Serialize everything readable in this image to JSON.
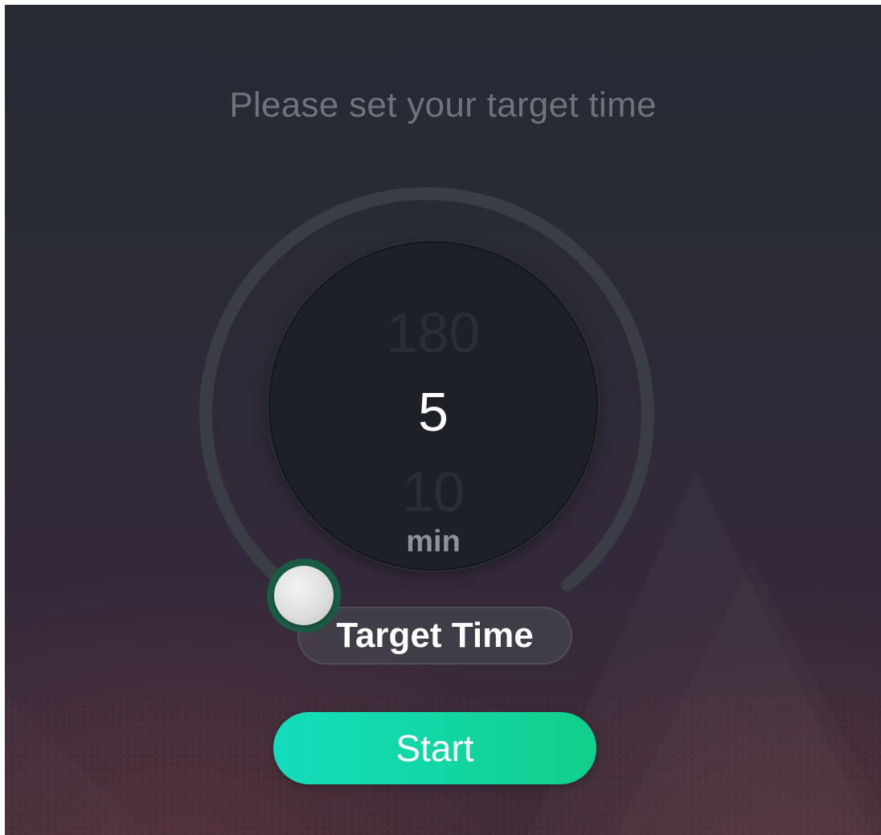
{
  "header": {
    "title": "Please set your target time"
  },
  "picker": {
    "previous_value": "180",
    "current_value": "5",
    "next_value": "10",
    "unit": "min"
  },
  "slider": {
    "label": "Target Time",
    "progress_fraction": 0.0
  },
  "actions": {
    "start_label": "Start"
  },
  "colors": {
    "accent_start": "#13ddbd",
    "accent_end": "#12cf8a",
    "handle_ring": "#1a5b46",
    "track": "#3a3d46"
  },
  "icons": {
    "slider_handle": "circle-knob-icon"
  }
}
